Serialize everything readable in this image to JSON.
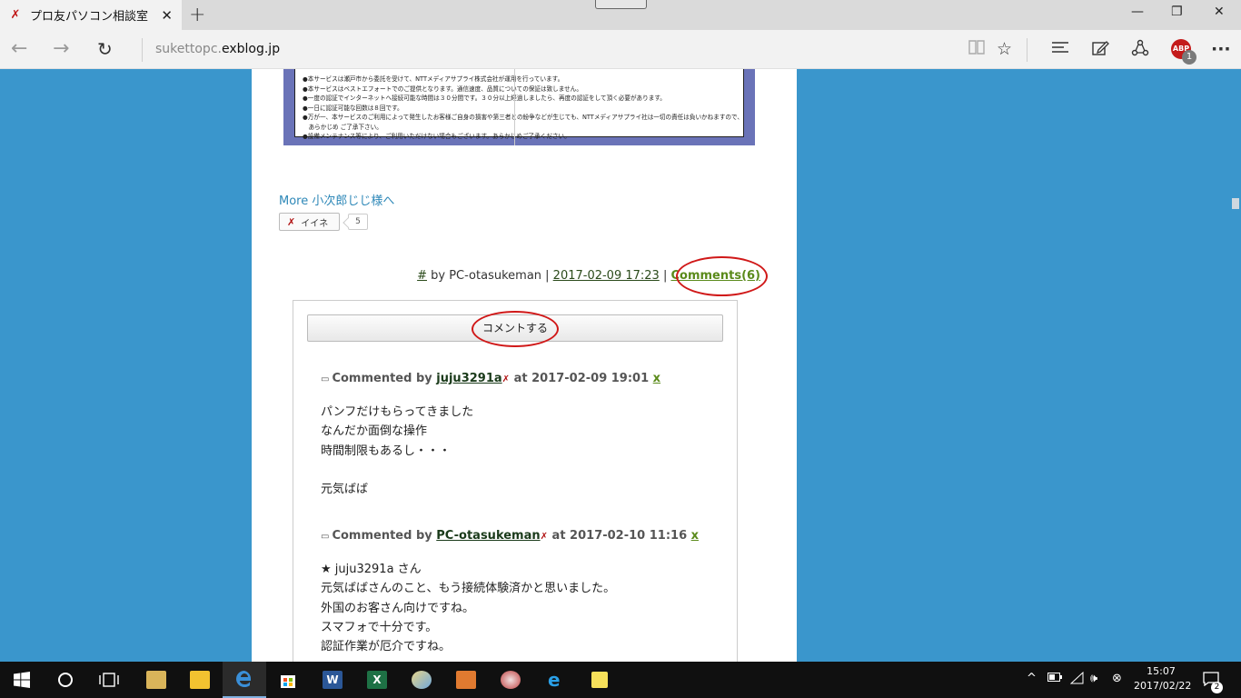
{
  "browser": {
    "tab_title": "プロ友パソコン相談室",
    "tab_favicon": "✗",
    "tab_close": "✕",
    "new_tab": "+",
    "window": {
      "minimize": "—",
      "restore": "❐",
      "close": "✕"
    },
    "nav": {
      "back": "←",
      "forward": "→",
      "refresh": "↻"
    },
    "address_prefix": "sukettopc.",
    "address_domain": "exblog.jp",
    "toolbar_icons": [
      "reading-view-icon",
      "favorite-star-icon",
      "hub-icon",
      "web-note-icon",
      "share-icon",
      "adblock-plus-icon",
      "more-icon"
    ],
    "abp_label": "ABP",
    "abp_count": "1",
    "more_label": "···"
  },
  "notice": {
    "lines": [
      "●本サービスは瀬戸市から委託を受けて、NTTメディアサプライ株式会社が運用を行っています。",
      "●本サービスはベストエフォートでのご提供となります。通信速度、品質についての保証は致しません。",
      "●一度の認証でインターネットへ接続可能な時間は３０分間です。３０分以上経過しましたら、再度の認証をして頂く必要があります。",
      "●一日に認証可能な回数は８回です。",
      "●万が一、本サービスのご利用によって発生したお客様ご自身の損害や第三者との紛争などが生じても、NTTメディアサプライ社は一切の責任は負いかねますので、",
      "　あらかじめ ご了承下さい。",
      "●設備メンテナンス等により、ご利用いただけない場合もございます。あらかじめご了承ください。"
    ]
  },
  "post": {
    "more_link": "More 小次郎じじ様へ",
    "iine_label": "イイネ",
    "iine_mark": "✗",
    "iine_count": "5",
    "permalink": "#",
    "by_text": " by PC-otasukeman | ",
    "date": "2017-02-09 17:23",
    "sep": " | ",
    "comments_link": "Comments(6)"
  },
  "comments": {
    "button_label": "コメントする",
    "items": [
      {
        "bubble": "💬",
        "prefix": "Commented by ",
        "author": "juju3291a",
        "mark": "✗",
        "at_text": " at 2017-02-09 19:01 ",
        "x": "x",
        "body": "パンフだけもらってきました\nなんだか面倒な操作\n時間制限もあるし・・・\n\n元気ばば"
      },
      {
        "bubble": "💬",
        "prefix": "Commented by ",
        "author": "PC-otasukeman",
        "mark": "✗",
        "at_text": " at 2017-02-10 11:16 ",
        "x": "x",
        "body": "★ juju3291a さん\n元気ばばさんのこと、もう接続体験済かと思いました。\n外国のお客さん向けですね。\nスマフォで十分です。\n認証作業が厄介ですね。"
      }
    ]
  },
  "taskbar": {
    "apps": [
      "windows-start-icon",
      "cortana-icon",
      "task-view-icon",
      "file-viewer-icon",
      "file-explorer-icon",
      "edge-icon",
      "store-icon",
      "word-icon",
      "excel-icon",
      "paint-icon",
      "toolbox-icon",
      "game-icon",
      "internet-explorer-icon",
      "sticky-notes-icon"
    ],
    "time": "15:07",
    "date": "2017/02/22",
    "notification_count": "2"
  },
  "colors": {
    "page_background": "#3a96cc",
    "highlight_ellipse": "#d01818",
    "link": "#2e88b8"
  }
}
